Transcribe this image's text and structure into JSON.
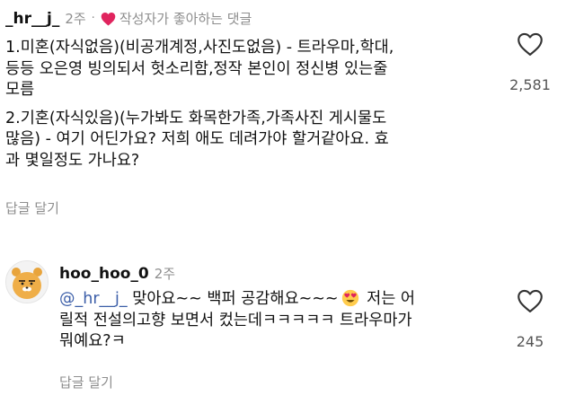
{
  "comments": [
    {
      "username": "_hr__j_",
      "time": "2주",
      "dot": "·",
      "creator_like_label": "작성자가 좋아하는 댓글",
      "paragraphs": [
        [
          "1.미혼(자식없음)(비공개계정,사진도없음) - 트라우마,학대,",
          "등등 오은영 빙의되서 헛소리함,정작 본인이 정신병 있는줄",
          "모름"
        ],
        [
          "2.기혼(자식있음)(누가봐도 화목한가족,가족사진 게시물도",
          "많음) - 여기 어딘가요? 저희 애도 데려가야 할거같아요. 효",
          "과 몇일정도 가나요?"
        ]
      ],
      "reply_label": "답글 달기",
      "like_count": "2,581"
    },
    {
      "username": "hoo_hoo_0",
      "time": "2주",
      "mention": "@_hr__j_",
      "line1_text": " 맞아요~~ 백퍼 공감해요~~~",
      "line1_after_emoji": " 저는 어",
      "line2": "릴적 전설의고향 보면서 컸는데ㅋㅋㅋㅋㅋ 트라우마가",
      "line3": "뭐예요?ㅋ",
      "emoji": "heart-eyes-emoji",
      "reply_label": "답글 달기",
      "like_count": "245"
    }
  ],
  "colors": {
    "creator_heart": "#e0245e",
    "mention": "#3b5ea8",
    "muted_text": "#8e8e8e"
  }
}
